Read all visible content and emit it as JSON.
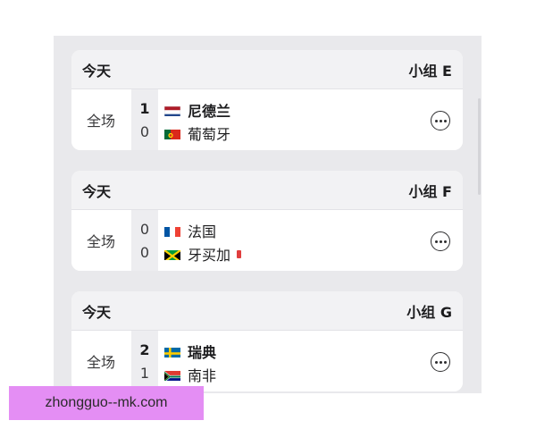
{
  "matches": [
    {
      "day": "今天",
      "group": "小组 E",
      "period": "全场",
      "home": {
        "name": "尼德兰",
        "score": "1",
        "flag": "netherlands-flag",
        "winner": true
      },
      "away": {
        "name": "葡萄牙",
        "score": "0",
        "flag": "portugal-flag",
        "winner": false
      }
    },
    {
      "day": "今天",
      "group": "小组 F",
      "period": "全场",
      "home": {
        "name": "法国",
        "score": "0",
        "flag": "france-flag",
        "winner": false
      },
      "away": {
        "name": "牙买加",
        "score": "0",
        "flag": "jamaica-flag",
        "winner": false,
        "red_card": true
      }
    },
    {
      "day": "今天",
      "group": "小组 G",
      "period": "全场",
      "home": {
        "name": "瑞典",
        "score": "2",
        "flag": "sweden-flag",
        "winner": true
      },
      "away": {
        "name": "南非",
        "score": "1",
        "flag": "south-africa-flag",
        "winner": false
      }
    }
  ],
  "overlay": {
    "text": "zhongguo--mk.com"
  },
  "colors": {
    "background": "#e9e9ec",
    "card": "#ffffff",
    "header": "#f2f2f4",
    "score_column": "#ededf0",
    "overlay": "#e48ef4",
    "red_card": "#e03e3e"
  }
}
